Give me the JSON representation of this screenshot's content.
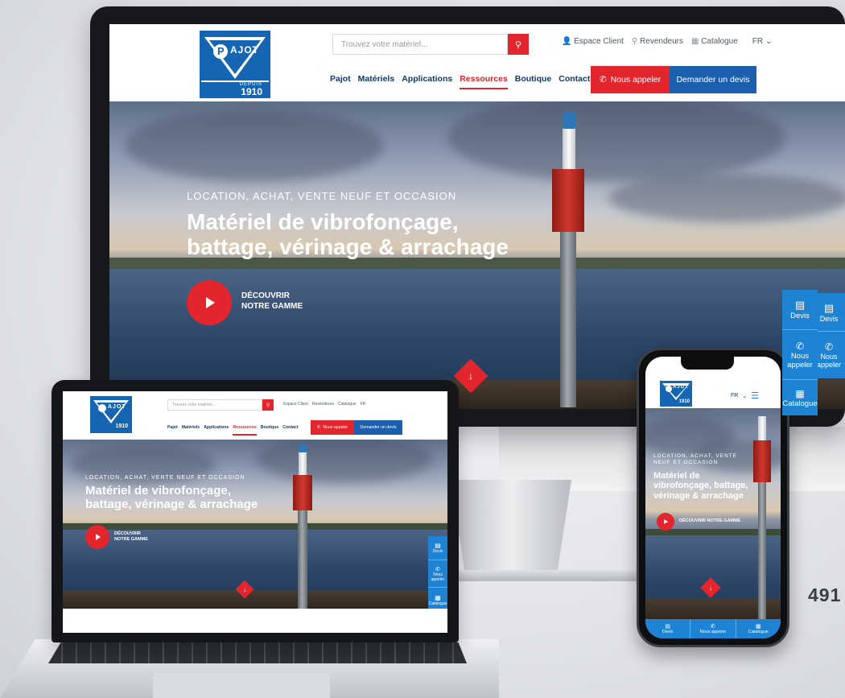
{
  "brand": {
    "name": "AJOT",
    "initial": "P",
    "since_label": "DEPUIS",
    "since_year": "1910",
    "blue": "#1565b3",
    "red": "#e3262d"
  },
  "header": {
    "search_placeholder": "Trouvez votre matériel...",
    "search_icon": "search-icon",
    "utility": {
      "client": "Espace Client",
      "dealers": "Revendeurs",
      "catalogue": "Catalogue",
      "lang": "FR"
    },
    "nav": [
      "Pajot",
      "Matériels",
      "Applications",
      "Ressources",
      "Boutique",
      "Contact"
    ],
    "active_nav": "Ressources",
    "call_label": "Nous appeler",
    "quote_label": "Demander un devis"
  },
  "hero": {
    "kicker": "LOCATION, ACHAT, VENTE NEUF ET OCCASION",
    "title_line1": "Matériel de vibrofonçage,",
    "title_line2": "battage, vérinage & arrachage",
    "cta_line1": "DÉCOUVRIR",
    "cta_line2": "NOTRE GAMME",
    "cta_single": "DÉCOUVRIR NOTRE GAMME"
  },
  "phone_hero": {
    "kicker_line1": "LOCATION, ACHAT, VENTE",
    "kicker_line2": "NEUF ET OCCASION",
    "title_line1": "Matériel de",
    "title_line2": "vibrofonçage, battage,",
    "title_line3": "vérinage & arrachage"
  },
  "side_tabs": {
    "devis": "Devis",
    "call_line1": "Nous",
    "call_line2": "appeler",
    "catalogue": "Catalogue"
  },
  "phone_bar": {
    "devis": "Devis",
    "call": "Nous appeler",
    "catalogue": "Catalogue"
  },
  "page_number": "491"
}
